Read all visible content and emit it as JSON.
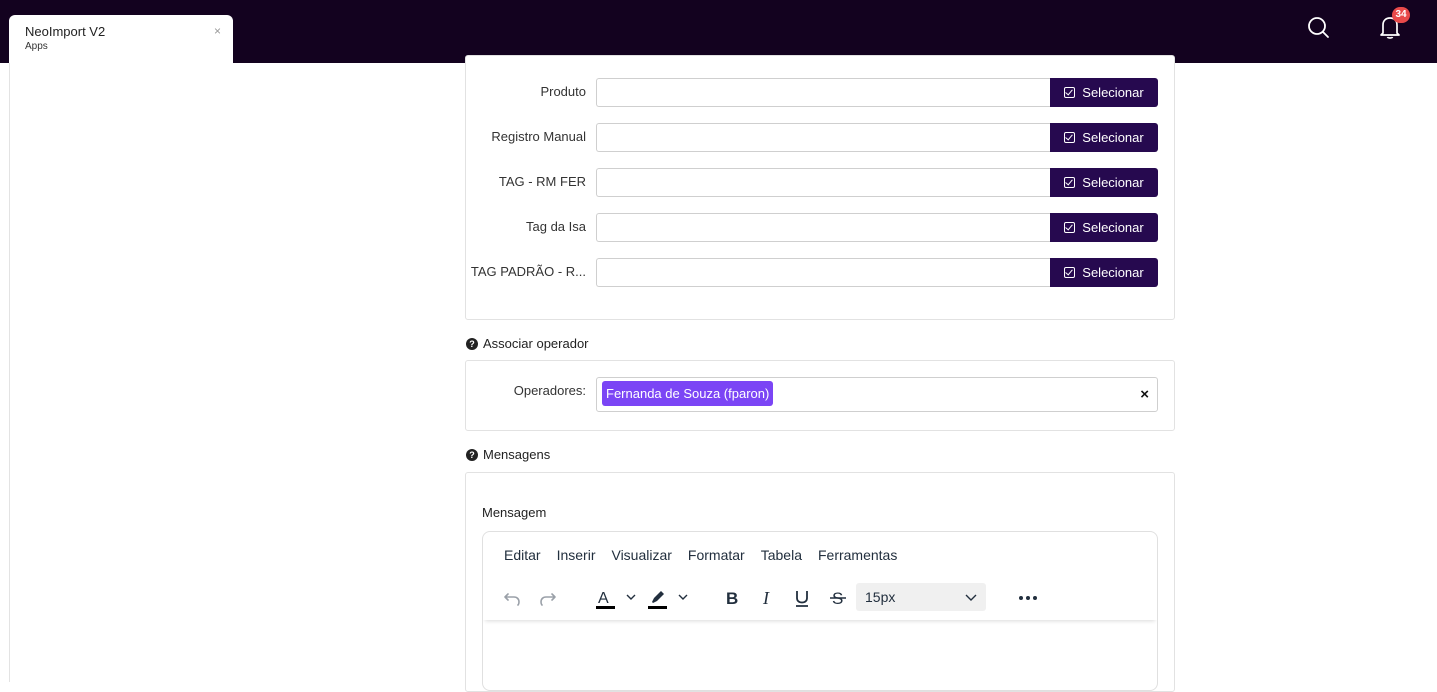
{
  "tab": {
    "title": "NeoImport V2",
    "subtitle": "Apps",
    "close": "×"
  },
  "header": {
    "notification_count": "34",
    "icons": [
      "search-icon",
      "bell-icon"
    ]
  },
  "colors": {
    "topbar": "#13021f",
    "button": "#26094f",
    "chip": "#7b45f5",
    "badge": "#e84a4a"
  },
  "tags": {
    "button_label": "Selecionar",
    "rows": [
      {
        "label": "Produto",
        "value": ""
      },
      {
        "label": "Registro Manual",
        "value": ""
      },
      {
        "label": "TAG - RM FER",
        "value": ""
      },
      {
        "label": "Tag da Isa",
        "value": ""
      },
      {
        "label": "TAG PADRÃO - R...",
        "value": ""
      }
    ]
  },
  "operators": {
    "section_title": "Associar operador",
    "label": "Operadores:",
    "selected": "Fernanda de Souza (fparon)",
    "clear": "×"
  },
  "messages": {
    "section_title": "Mensagens",
    "field_label": "Mensagem",
    "menu": [
      "Editar",
      "Inserir",
      "Visualizar",
      "Formatar",
      "Tabela",
      "Ferramentas"
    ],
    "font_size": "15px",
    "toolbar_icons": [
      "undo-icon",
      "redo-icon",
      "text-color-icon",
      "highlight-icon",
      "bold-icon",
      "italic-icon",
      "underline-icon",
      "strikethrough-icon",
      "more-icon"
    ]
  }
}
